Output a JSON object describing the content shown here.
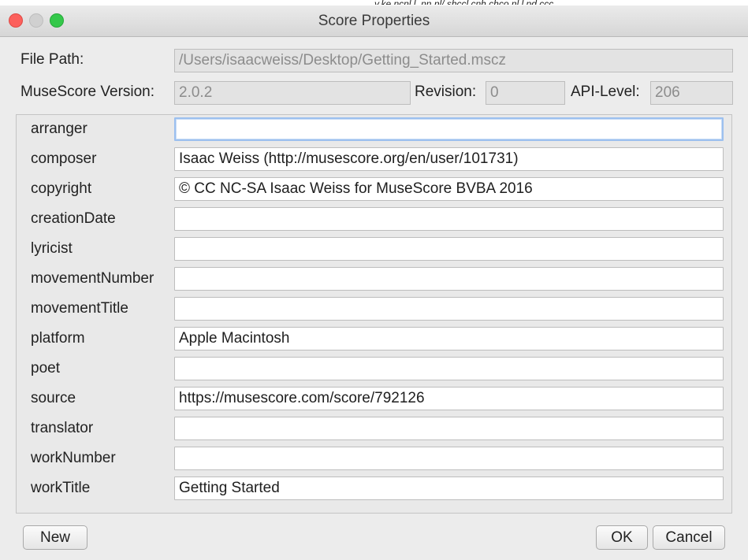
{
  "window": {
    "title": "Score Properties"
  },
  "header": {
    "file_path_label": "File Path:",
    "file_path_value": "/Users/isaacweiss/Desktop/Getting_Started.mscz",
    "version_label": "MuseScore Version:",
    "version_value": "2.0.2",
    "revision_label": "Revision:",
    "revision_value": "0",
    "api_label": "API-Level:",
    "api_value": "206"
  },
  "metadata": [
    {
      "key": "arranger",
      "value": ""
    },
    {
      "key": "composer",
      "value": "Isaac Weiss (http://musescore.org/en/user/101731)"
    },
    {
      "key": "copyright",
      "value": "© CC NC-SA Isaac Weiss for MuseScore BVBA 2016"
    },
    {
      "key": "creationDate",
      "value": ""
    },
    {
      "key": "lyricist",
      "value": ""
    },
    {
      "key": "movementNumber",
      "value": ""
    },
    {
      "key": "movementTitle",
      "value": ""
    },
    {
      "key": "platform",
      "value": "Apple Macintosh"
    },
    {
      "key": "poet",
      "value": ""
    },
    {
      "key": "source",
      "value": "https://musescore.com/score/792126"
    },
    {
      "key": "translator",
      "value": ""
    },
    {
      "key": "workNumber",
      "value": ""
    },
    {
      "key": "workTitle",
      "value": "Getting Started"
    }
  ],
  "buttons": {
    "new": "New",
    "ok": "OK",
    "cancel": "Cancel"
  },
  "clipped_text": "y.ke.ncnl.l .nn.nl/.shccl.cnh.chco.nl.l pd.ccc"
}
